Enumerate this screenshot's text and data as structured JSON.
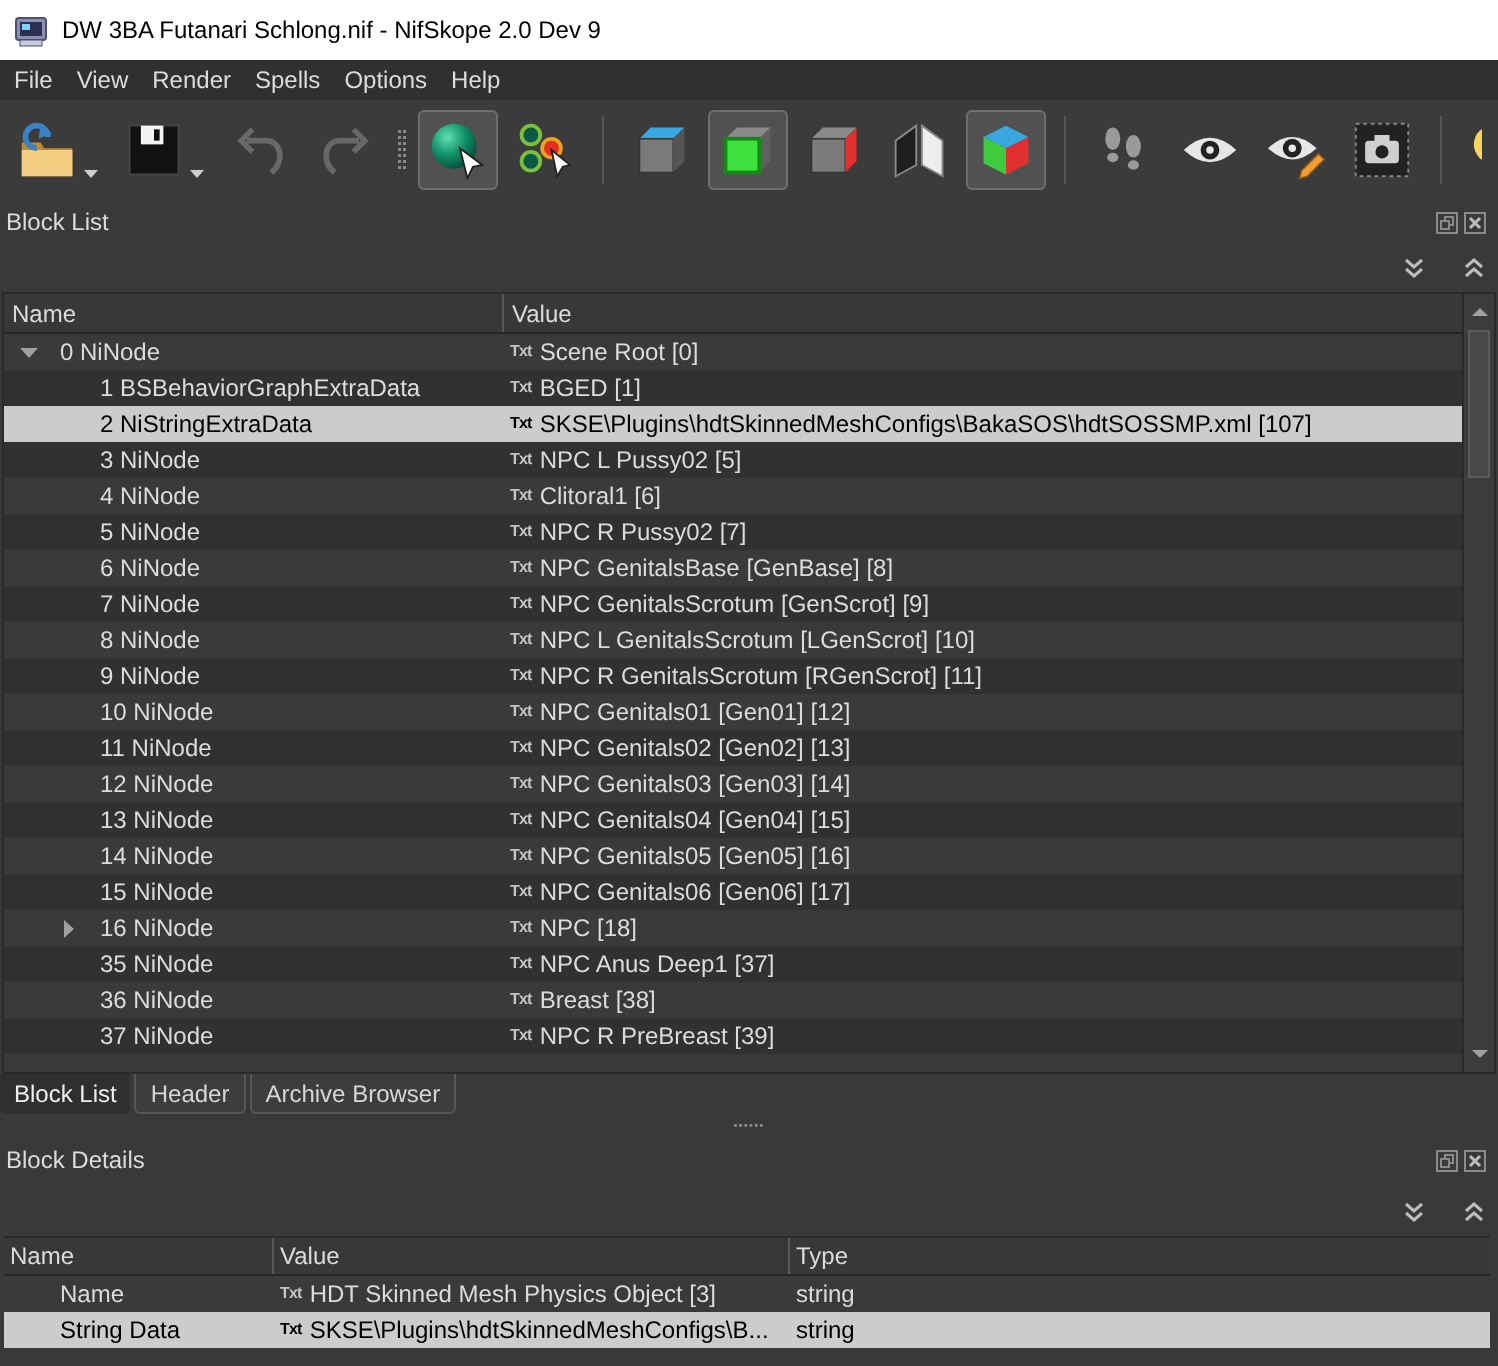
{
  "window": {
    "title": "DW 3BA Futanari Schlong.nif - NifSkope 2.0 Dev 9"
  },
  "menu_bar": [
    "File",
    "View",
    "Render",
    "Spells",
    "Options",
    "Help"
  ],
  "toolbar": {
    "groups": [
      {
        "grip": false,
        "separator": false,
        "items": [
          {
            "kind": "open",
            "dropdown": true,
            "active": false,
            "disabled": false
          },
          {
            "kind": "save",
            "dropdown": true,
            "active": false,
            "disabled": false
          },
          {
            "kind": "undo",
            "dropdown": false,
            "active": false,
            "disabled": true
          },
          {
            "kind": "redo",
            "dropdown": false,
            "active": false,
            "disabled": true
          }
        ]
      },
      {
        "grip": true,
        "separator": false,
        "items": [
          {
            "kind": "select",
            "dropdown": false,
            "active": true,
            "disabled": false
          },
          {
            "kind": "vertex",
            "dropdown": false,
            "active": false,
            "disabled": false
          }
        ]
      },
      {
        "grip": false,
        "separator": true,
        "items": [
          {
            "kind": "top",
            "dropdown": false,
            "active": false,
            "disabled": false
          },
          {
            "kind": "front",
            "dropdown": false,
            "active": true,
            "disabled": false
          },
          {
            "kind": "side",
            "dropdown": false,
            "active": false,
            "disabled": false
          },
          {
            "kind": "ortho",
            "dropdown": false,
            "active": false,
            "disabled": false
          },
          {
            "kind": "user",
            "dropdown": false,
            "active": true,
            "disabled": false
          }
        ]
      },
      {
        "grip": false,
        "separator": true,
        "items": [
          {
            "kind": "walk",
            "dropdown": false,
            "active": false,
            "disabled": false
          },
          {
            "kind": "eye",
            "dropdown": false,
            "active": false,
            "disabled": false
          },
          {
            "kind": "pencil",
            "dropdown": false,
            "active": false,
            "disabled": false
          },
          {
            "kind": "camera",
            "dropdown": false,
            "active": false,
            "disabled": false
          }
        ]
      },
      {
        "grip": false,
        "separator": true,
        "items": [
          {
            "kind": "light",
            "dropdown": false,
            "active": false,
            "disabled": false
          }
        ]
      }
    ]
  },
  "block_list": {
    "title": "Block List",
    "columns": [
      "Name",
      "Value"
    ],
    "rows": [
      {
        "kind": "branch",
        "name": "0 NiNode",
        "tag": "Txt",
        "value": "Scene Root [0]",
        "expanded": true,
        "selected": false,
        "children": [
          {
            "kind": "leaf",
            "name": "1 BSBehaviorGraphExtraData",
            "tag": "Txt",
            "value": "BGED [1]",
            "selected": false
          },
          {
            "kind": "leaf",
            "name": "2 NiStringExtraData",
            "tag": "Txt",
            "value": "SKSE\\Plugins\\hdtSkinnedMeshConfigs\\BakaSOS\\hdtSOSSMP.xml [107]",
            "selected": true
          },
          {
            "kind": "leaf",
            "name": "3 NiNode",
            "tag": "Txt",
            "value": "NPC L Pussy02 [5]",
            "selected": false
          },
          {
            "kind": "leaf",
            "name": "4 NiNode",
            "tag": "Txt",
            "value": "Clitoral1 [6]",
            "selected": false
          },
          {
            "kind": "leaf",
            "name": "5 NiNode",
            "tag": "Txt",
            "value": "NPC R Pussy02 [7]",
            "selected": false
          },
          {
            "kind": "leaf",
            "name": "6 NiNode",
            "tag": "Txt",
            "value": "NPC GenitalsBase [GenBase] [8]",
            "selected": false
          },
          {
            "kind": "leaf",
            "name": "7 NiNode",
            "tag": "Txt",
            "value": "NPC GenitalsScrotum [GenScrot] [9]",
            "selected": false
          },
          {
            "kind": "leaf",
            "name": "8 NiNode",
            "tag": "Txt",
            "value": "NPC L GenitalsScrotum [LGenScrot] [10]",
            "selected": false
          },
          {
            "kind": "leaf",
            "name": "9 NiNode",
            "tag": "Txt",
            "value": "NPC R GenitalsScrotum [RGenScrot] [11]",
            "selected": false
          },
          {
            "kind": "leaf",
            "name": "10 NiNode",
            "tag": "Txt",
            "value": "NPC Genitals01 [Gen01] [12]",
            "selected": false
          },
          {
            "kind": "leaf",
            "name": "11 NiNode",
            "tag": "Txt",
            "value": "NPC Genitals02 [Gen02] [13]",
            "selected": false
          },
          {
            "kind": "leaf",
            "name": "12 NiNode",
            "tag": "Txt",
            "value": "NPC Genitals03 [Gen03] [14]",
            "selected": false
          },
          {
            "kind": "leaf",
            "name": "13 NiNode",
            "tag": "Txt",
            "value": "NPC Genitals04 [Gen04] [15]",
            "selected": false
          },
          {
            "kind": "leaf",
            "name": "14 NiNode",
            "tag": "Txt",
            "value": "NPC Genitals05 [Gen05] [16]",
            "selected": false
          },
          {
            "kind": "leaf",
            "name": "15 NiNode",
            "tag": "Txt",
            "value": "NPC Genitals06 [Gen06] [17]",
            "selected": false
          },
          {
            "kind": "branch",
            "name": "16 NiNode",
            "tag": "Txt",
            "value": "NPC [18]",
            "expanded": false,
            "selected": false
          },
          {
            "kind": "leaf",
            "name": "35 NiNode",
            "tag": "Txt",
            "value": "NPC Anus Deep1 [37]",
            "selected": false
          },
          {
            "kind": "leaf",
            "name": "36 NiNode",
            "tag": "Txt",
            "value": "Breast [38]",
            "selected": false
          },
          {
            "kind": "leaf",
            "name": "37 NiNode",
            "tag": "Txt",
            "value": "NPC R PreBreast [39]",
            "selected": false
          }
        ]
      }
    ]
  },
  "tabs": [
    {
      "label": "Block List",
      "selected": true
    },
    {
      "label": "Header",
      "selected": false
    },
    {
      "label": "Archive Browser",
      "selected": false
    }
  ],
  "block_details": {
    "title": "Block Details",
    "columns": [
      "Name",
      "Value",
      "Type"
    ],
    "rows": [
      {
        "name": "Name",
        "tag": "Txt",
        "value": "HDT Skinned Mesh Physics Object [3]",
        "type": "string",
        "selected": false
      },
      {
        "name": "String Data",
        "tag": "Txt",
        "value": "SKSE\\Plugins\\hdtSkinnedMeshConfigs\\B...",
        "type": "string",
        "selected": true
      }
    ]
  }
}
